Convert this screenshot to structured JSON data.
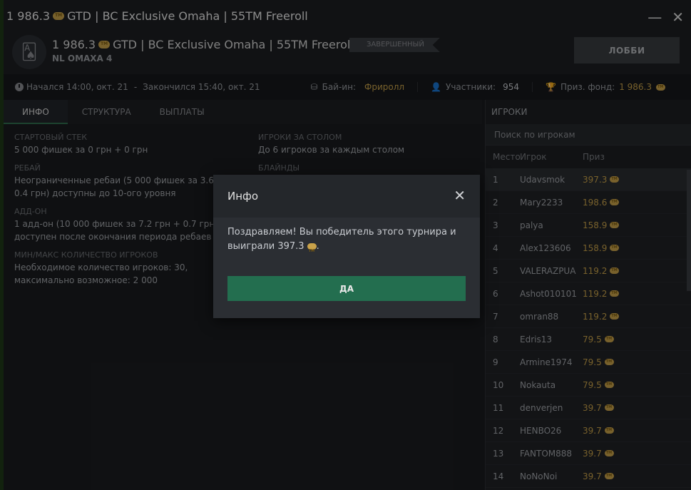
{
  "window": {
    "title_amount": "1 986.3",
    "title_text": "GTD | BC Exclusive Omaha | 55TM Freeroll",
    "minimize": "—",
    "close": "✕"
  },
  "header": {
    "amount": "1 986.3",
    "title": "GTD | BC Exclusive Omaha | 55TM Freeroll",
    "subtitle": "NL OMAXA 4",
    "status": "ЗАВЕРШЕННЫЙ",
    "lobby_label": "ЛОББИ"
  },
  "infobar": {
    "started": "Начался 14:00, окт. 21",
    "dash": "-",
    "ended": "Закончился 15:40, окт. 21",
    "buyin_label": "Бай-ин:",
    "buyin_value": "Фриролл",
    "participants_label": "Участники:",
    "participants_value": "954",
    "prize_label": "Приз. фонд:",
    "prize_value": "1 986.3"
  },
  "tabs": [
    "ИНФО",
    "СТРУКТУРА",
    "ВЫПЛАТЫ"
  ],
  "info": {
    "left": [
      {
        "label": "СТАРТОВЫЙ СТЕК",
        "value": "5 000 фишек за 0 грн + 0 грн"
      },
      {
        "label": "РЕБАЙ",
        "value": "Неограниченные ребаи (5 000 фишек за 3.6 грн + 0.4 грн) доступны до 10-ого уровня"
      },
      {
        "label": "АДД-ОН",
        "value": "1 адд-он (10 000 фишек за 7.2 грн + 0.7 грн) доступен после окончания периода ребаев"
      },
      {
        "label": "МИН/МАКС КОЛИЧЕСТВО ИГРОКОВ",
        "value": "Необходимое количество игроков: 30, максимально возможное: 2 000"
      }
    ],
    "right": [
      {
        "label": "ИГРОКИ ЗА СТОЛОМ",
        "value": "До 6 игроков за каждым столом"
      },
      {
        "label": "БЛАЙНДЫ",
        "value": ""
      }
    ]
  },
  "players": {
    "title": "ИГРОКИ",
    "search_placeholder": "Поиск по игрокам",
    "columns": [
      "Место",
      "Игрок",
      "Приз"
    ],
    "rows": [
      {
        "pos": "1",
        "name": "Udavsmok",
        "prize": "397.3"
      },
      {
        "pos": "2",
        "name": "Mary2233",
        "prize": "198.6"
      },
      {
        "pos": "3",
        "name": "palya",
        "prize": "158.9"
      },
      {
        "pos": "4",
        "name": "Alex123606",
        "prize": "158.9"
      },
      {
        "pos": "5",
        "name": "VALERAZPUA",
        "prize": "119.2"
      },
      {
        "pos": "6",
        "name": "Ashot010101",
        "prize": "119.2"
      },
      {
        "pos": "7",
        "name": "omran88",
        "prize": "119.2"
      },
      {
        "pos": "8",
        "name": "Edris13",
        "prize": "79.5"
      },
      {
        "pos": "9",
        "name": "Armine1974",
        "prize": "79.5"
      },
      {
        "pos": "10",
        "name": "Nokauta",
        "prize": "79.5"
      },
      {
        "pos": "11",
        "name": "denverjen",
        "prize": "39.7"
      },
      {
        "pos": "12",
        "name": "HENBO26",
        "prize": "39.7"
      },
      {
        "pos": "13",
        "name": "FANTOM888",
        "prize": "39.7"
      },
      {
        "pos": "14",
        "name": "NoNoNoi",
        "prize": "39.7"
      }
    ]
  },
  "modal": {
    "title": "Инфо",
    "close": "✕",
    "message": "Поздравляем! Вы победитель этого турнира и выиграли 397.3",
    "message_end": ".",
    "ok_label": "ДА"
  },
  "colors": {
    "accent": "#236e4f",
    "gold": "#c9a24a",
    "background": "#1a1c1f"
  }
}
